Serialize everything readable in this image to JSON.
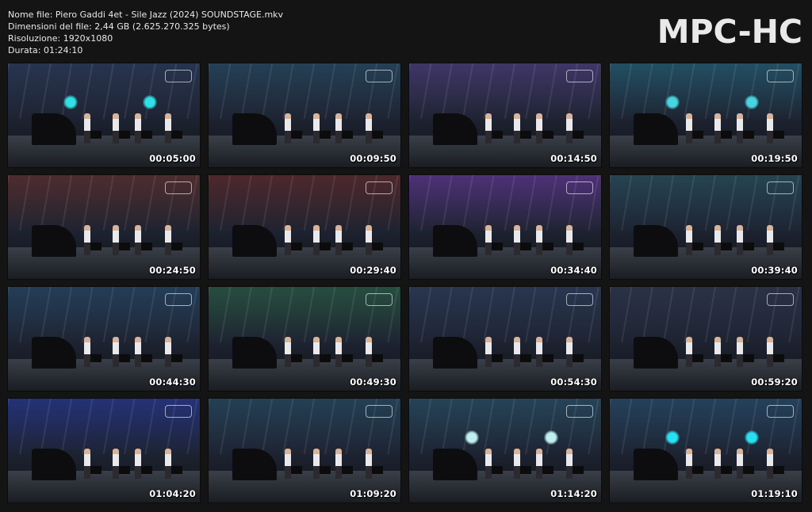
{
  "info": {
    "filename": "Nome file: Piero Gaddi 4et - Sile Jazz (2024) SOUNDSTAGE.mkv",
    "filesize": "Dimensioni del file: 2,44 GB (2.625.270.325 bytes)",
    "resolution": "Risoluzione: 1920x1080",
    "duration": "Durata: 01:24:10"
  },
  "logo": "MPC-HC",
  "colors": {
    "background": "#141414",
    "text": "#e8e8e8"
  },
  "thumbnails": [
    {
      "time": "00:05:00",
      "tint": "#2e3d5c",
      "spot": "#2fe0e6"
    },
    {
      "time": "00:09:50",
      "tint": "#2b4a63",
      "spot": ""
    },
    {
      "time": "00:14:50",
      "tint": "#4a3f78",
      "spot": ""
    },
    {
      "time": "00:19:50",
      "tint": "#285c73",
      "spot": "#47d6e0"
    },
    {
      "time": "00:24:50",
      "tint": "#5a3436",
      "spot": ""
    },
    {
      "time": "00:29:40",
      "tint": "#5a2f33",
      "spot": ""
    },
    {
      "time": "00:34:40",
      "tint": "#5a3a8a",
      "spot": ""
    },
    {
      "time": "00:39:40",
      "tint": "#2c4f60",
      "spot": ""
    },
    {
      "time": "00:44:30",
      "tint": "#2a4866",
      "spot": ""
    },
    {
      "time": "00:49:30",
      "tint": "#2d5a4a",
      "spot": ""
    },
    {
      "time": "00:54:30",
      "tint": "#2f3f5c",
      "spot": ""
    },
    {
      "time": "00:59:20",
      "tint": "#323a52",
      "spot": ""
    },
    {
      "time": "01:04:20",
      "tint": "#2a3a8a",
      "spot": ""
    },
    {
      "time": "01:09:20",
      "tint": "#2a4a62",
      "spot": ""
    },
    {
      "time": "01:14:20",
      "tint": "#2c4e66",
      "spot": "#bff0f0"
    },
    {
      "time": "01:19:10",
      "tint": "#2a4c6a",
      "spot": "#27e0f0"
    }
  ]
}
